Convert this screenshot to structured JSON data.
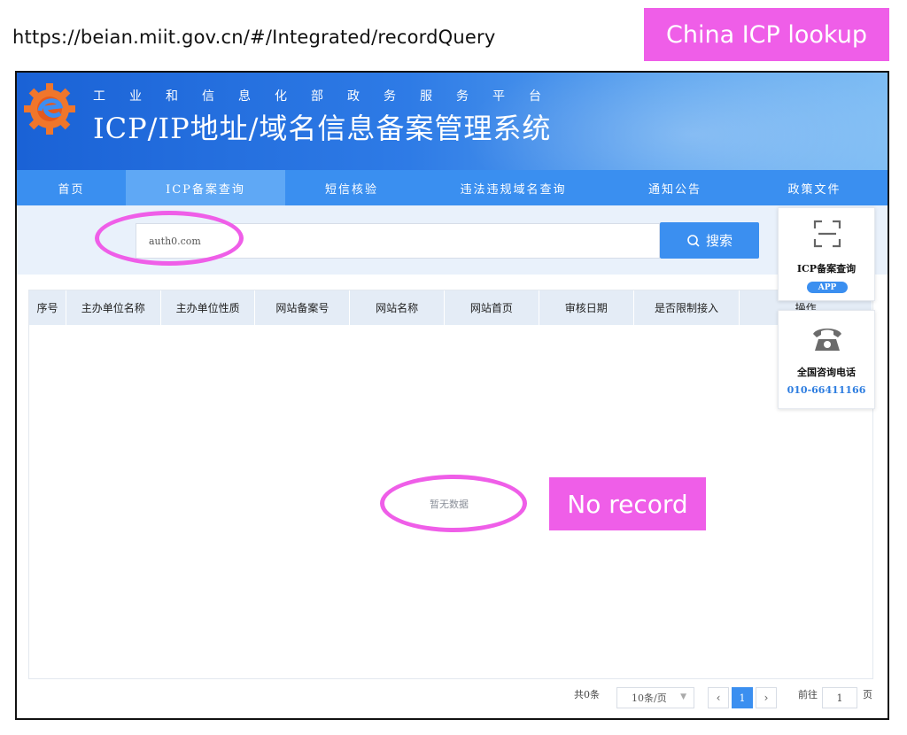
{
  "annotations": {
    "url": "https://beian.miit.gov.cn/#/Integrated/recordQuery",
    "top_tag": "China ICP lookup",
    "result_tag": "No record",
    "highlight_color": "#ef5ee8"
  },
  "header": {
    "subtitle": "工业和信息化部政务服务平台",
    "title": "ICP/IP地址/域名信息备案管理系统",
    "logo_icon": "gear-logo-icon",
    "brand_color": "#2e7be6"
  },
  "nav": {
    "items": [
      {
        "label": "首页",
        "active": false
      },
      {
        "label": "ICP备案查询",
        "active": true
      },
      {
        "label": "短信核验",
        "active": false
      },
      {
        "label": "违法违规域名查询",
        "active": false
      },
      {
        "label": "通知公告",
        "active": false
      },
      {
        "label": "政策文件",
        "active": false
      }
    ]
  },
  "search": {
    "value": "auth0.com",
    "button_label": "搜索",
    "button_icon": "search-icon"
  },
  "table": {
    "columns": [
      "序号",
      "主办单位名称",
      "主办单位性质",
      "网站备案号",
      "网站名称",
      "网站首页",
      "审核日期",
      "是否限制接入",
      "操作"
    ],
    "rows": [],
    "empty_text": "暂无数据"
  },
  "pagination": {
    "total_text": "共0条",
    "page_size": "10条/页",
    "current_page": "1",
    "goto_label": "前往",
    "goto_value": "1",
    "page_suffix": "页"
  },
  "side": {
    "qr_title": "ICP备案查询",
    "qr_badge": "APP",
    "qr_icon": "qr-scan-icon",
    "phone_title": "全国咨询电话",
    "phone_number": "010-66411166",
    "phone_icon": "telephone-icon"
  }
}
